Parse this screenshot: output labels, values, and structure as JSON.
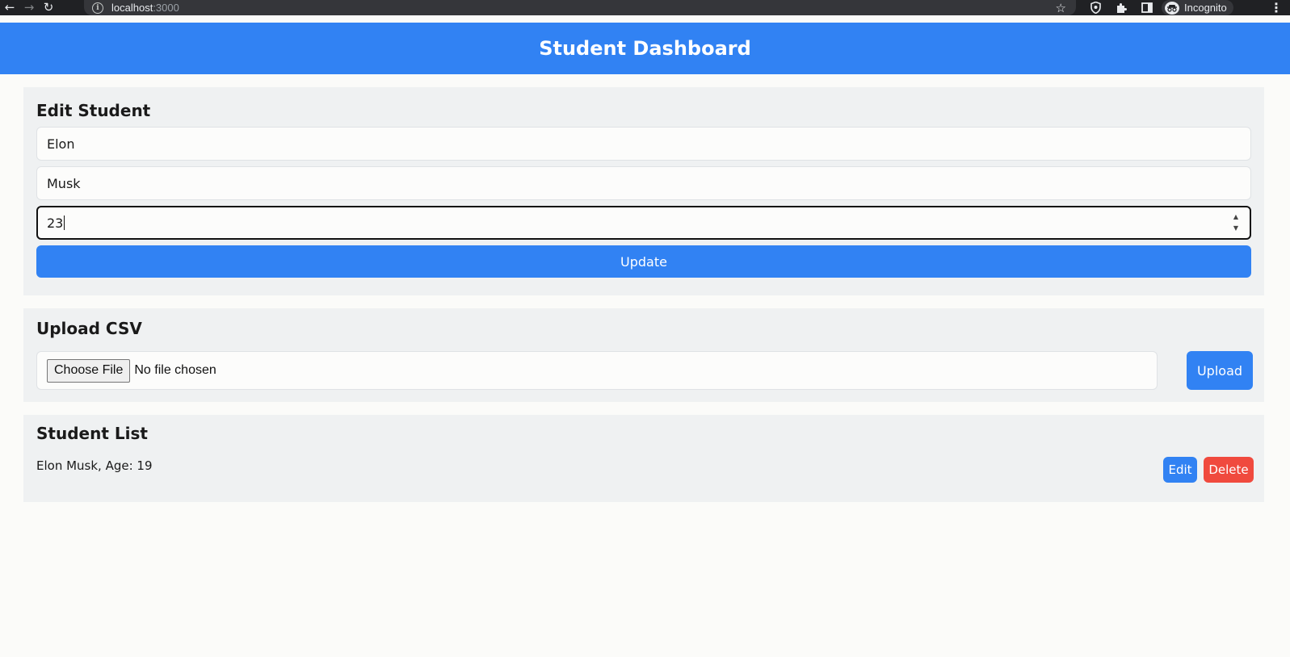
{
  "browser": {
    "url_host": "localhost",
    "url_port": ":3000",
    "profile_label": "Incognito"
  },
  "header": {
    "title": "Student Dashboard"
  },
  "edit_student": {
    "title": "Edit Student",
    "first_name": "Elon",
    "last_name": "Musk",
    "age": "23",
    "update_label": "Update"
  },
  "upload_csv": {
    "title": "Upload CSV",
    "choose_file_label": "Choose File",
    "file_status": "No file chosen",
    "upload_label": "Upload"
  },
  "student_list": {
    "title": "Student List",
    "students": [
      {
        "text": "Elon Musk, Age: 19",
        "edit_label": "Edit",
        "delete_label": "Delete"
      }
    ]
  },
  "colors": {
    "primary": "#3182f3",
    "danger": "#f04a3e",
    "panel_bg": "#eff1f2",
    "page_bg": "#fbfbf9"
  },
  "icons": {
    "back": "arrow-left-icon",
    "forward": "arrow-right-icon",
    "reload": "reload-icon",
    "info": "info-icon",
    "bookmark": "star-icon",
    "shield": "shield-icon",
    "extensions": "puzzle-icon",
    "side_panel": "side-panel-icon",
    "incognito": "incognito-icon",
    "menu": "kebab-menu-icon"
  }
}
